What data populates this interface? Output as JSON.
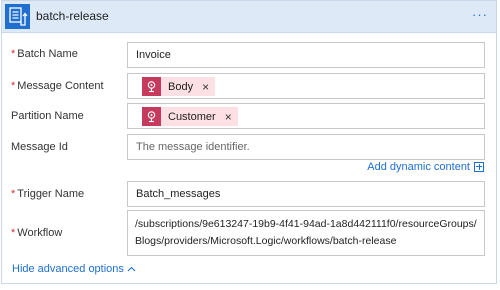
{
  "header": {
    "title": "batch-release",
    "more_label": "···",
    "icon": "batch-action-icon",
    "color": "#1f6fd0"
  },
  "fields": {
    "batch_name": {
      "label": "Batch Name",
      "required": "*",
      "value": "Invoice"
    },
    "message_content": {
      "label": "Message Content",
      "required": "*",
      "token": "Body",
      "token_close": "×"
    },
    "partition_name": {
      "label": "Partition Name",
      "token": "Customer",
      "token_close": "×"
    },
    "message_id": {
      "label": "Message Id",
      "placeholder": "The message identifier."
    },
    "trigger_name": {
      "label": "Trigger Name",
      "required": "*",
      "value": "Batch_messages"
    },
    "workflow": {
      "label": "Workflow",
      "required": "*",
      "value": "/subscriptions/9e613247-19b9-4f41-94ad-1a8d442111f0/resourceGroups/Blogs/providers/Microsoft.Logic/workflows/batch-release"
    }
  },
  "dynamic_content_label": "Add dynamic content",
  "advanced_toggle_label": "Hide advanced options",
  "colors": {
    "token_bg": "#fde0e4",
    "token_icon_bg": "#c53b5e",
    "link": "#1f6fd0",
    "required": "#d13438"
  }
}
